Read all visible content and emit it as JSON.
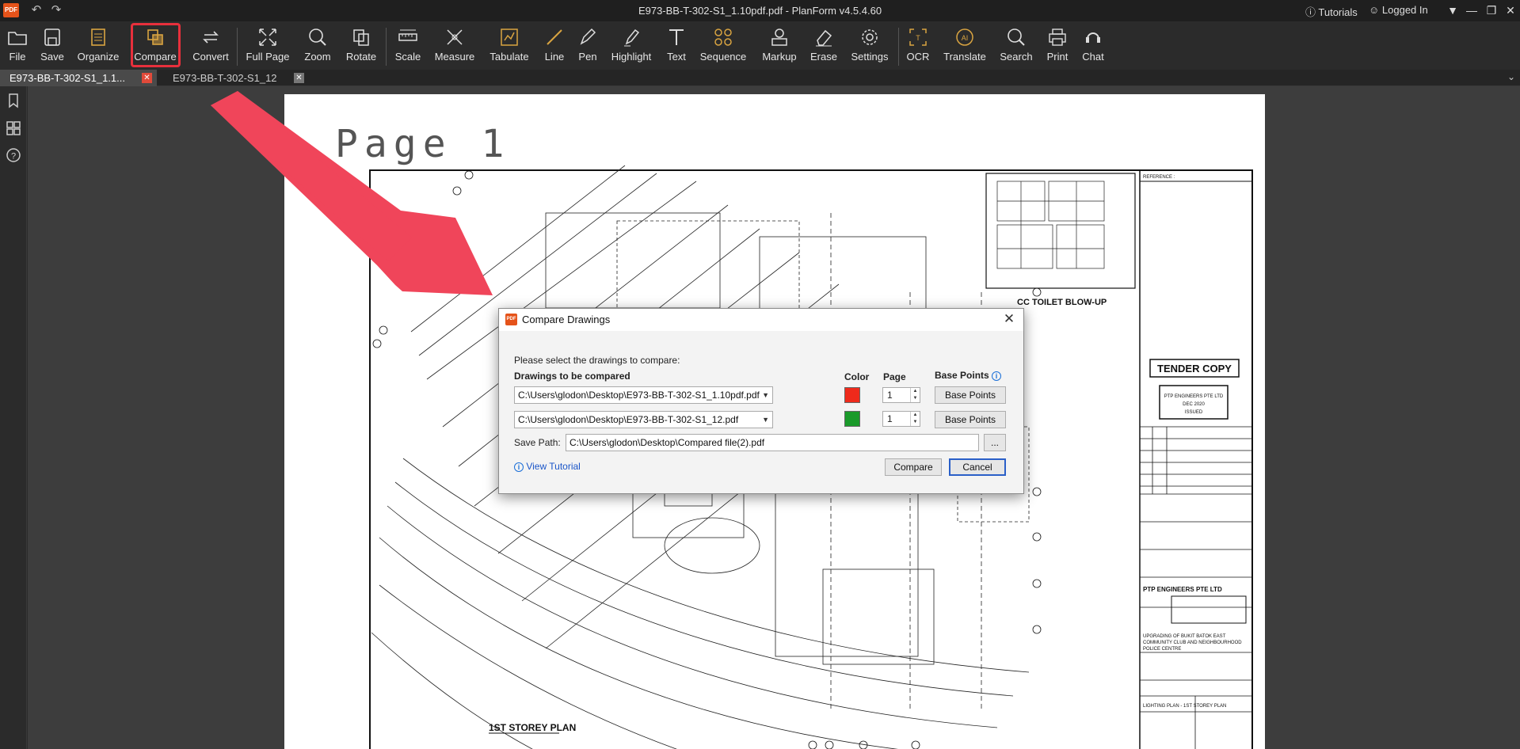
{
  "titlebar": {
    "logo": "PDF",
    "title": "E973-BB-T-302-S1_1.10pdf.pdf - PlanForm v4.5.4.60",
    "tutorials": "Tutorials",
    "login": "Logged In"
  },
  "toolbar": {
    "items": [
      {
        "label": "File",
        "icon": "folder-icon"
      },
      {
        "label": "Save",
        "icon": "save-icon"
      },
      {
        "label": "Organize",
        "icon": "organize-icon"
      },
      {
        "label": "Compare",
        "icon": "compare-icon",
        "active": true
      },
      {
        "label": "Convert",
        "icon": "convert-icon"
      },
      {
        "label": "Full Page",
        "icon": "full-page-icon"
      },
      {
        "label": "Zoom",
        "icon": "zoom-icon"
      },
      {
        "label": "Rotate",
        "icon": "rotate-icon"
      },
      {
        "label": "Scale",
        "icon": "scale-icon"
      },
      {
        "label": "Measure",
        "icon": "measure-icon"
      },
      {
        "label": "Tabulate",
        "icon": "tabulate-icon"
      },
      {
        "label": "Line",
        "icon": "line-icon"
      },
      {
        "label": "Pen",
        "icon": "pen-icon"
      },
      {
        "label": "Highlight",
        "icon": "highlight-icon"
      },
      {
        "label": "Text",
        "icon": "text-icon"
      },
      {
        "label": "Sequence",
        "icon": "sequence-icon"
      },
      {
        "label": "Markup",
        "icon": "markup-icon"
      },
      {
        "label": "Erase",
        "icon": "erase-icon"
      },
      {
        "label": "Settings",
        "icon": "settings-icon"
      },
      {
        "label": "OCR",
        "icon": "ocr-icon"
      },
      {
        "label": "Translate",
        "icon": "translate-icon"
      },
      {
        "label": "Search",
        "icon": "search-icon"
      },
      {
        "label": "Print",
        "icon": "print-icon"
      },
      {
        "label": "Chat",
        "icon": "chat-icon"
      }
    ]
  },
  "tabs": [
    {
      "label": "E973-BB-T-302-S1_1.1...",
      "active": true
    },
    {
      "label": "E973-BB-T-302-S1_12",
      "active": false
    }
  ],
  "document": {
    "page_label": "Page 1",
    "plan_title": "1ST STOREY PLAN",
    "blowup_title": "CC TOILET BLOW-UP",
    "tender": "TENDER COPY",
    "company": "PTP ENGINEERS PTE LTD",
    "project": "UPGRADING OF BUKIT BATOK EAST COMMUNITY CLUB AND NEIGHBOURHOOD POLICE CENTRE",
    "drawing_title": "LIGHTING PLAN - 1ST STOREY PLAN"
  },
  "dialog": {
    "title": "Compare Drawings",
    "instruction": "Please select the drawings to compare:",
    "col_drawings": "Drawings to be compared",
    "col_color": "Color",
    "col_page": "Page",
    "col_base": "Base Points",
    "rows": [
      {
        "path": "C:\\Users\\glodon\\Desktop\\E973-BB-T-302-S1_1.10pdf.pdf",
        "color": "#ee2a1b",
        "page": "1",
        "base_label": "Base Points"
      },
      {
        "path": "C:\\Users\\glodon\\Desktop\\E973-BB-T-302-S1_12.pdf",
        "color": "#1a9a2a",
        "page": "1",
        "base_label": "Base Points"
      }
    ],
    "save_label": "Save Path:",
    "save_path": "C:\\Users\\glodon\\Desktop\\Compared file(2).pdf",
    "browse": "...",
    "tutorial": "View Tutorial",
    "compare_btn": "Compare",
    "cancel_btn": "Cancel"
  },
  "colors": {
    "accent": "#e8303c",
    "arrow": "#f0455a",
    "logo": "#e5531a"
  }
}
